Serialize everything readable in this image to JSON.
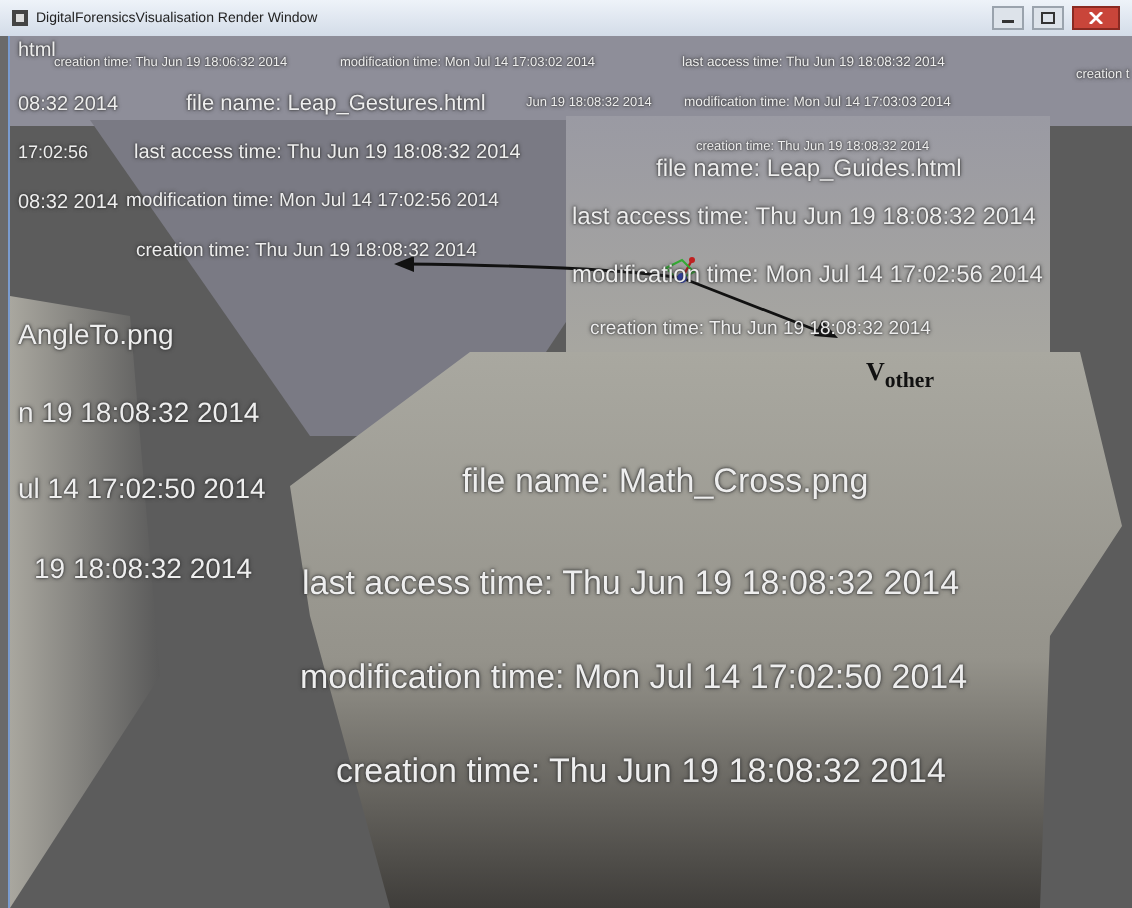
{
  "window": {
    "title": "DigitalForensicsVisualisation Render Window"
  },
  "scene": {
    "labels": [
      "html",
      "creation time: Thu Jun 19 18:06:32 2014",
      "modification time: Mon Jul 14 17:03:02 2014",
      "last access time: Thu Jun 19 18:08:32 2014",
      "creation t",
      "08:32 2014",
      "file name: Leap_Gestures.html",
      "Jun 19 18:08:32 2014",
      "modification time: Mon Jul 14 17:03:03 2014",
      "17:02:56",
      "last access time: Thu Jun 19 18:08:32 2014",
      "creation time: Thu Jun 19 18:08:32 2014",
      "file name: Leap_Guides.html",
      "08:32 2014",
      "modification time: Mon Jul 14 17:02:56 2014",
      "last access time: Thu Jun 19 18:08:32 2014",
      "creation time: Thu Jun 19 18:08:32 2014",
      "modification time: Mon Jul 14 17:02:56 2014",
      "AngleTo.png",
      "creation time: Thu Jun 19 18:08:32 2014",
      "n 19 18:08:32 2014",
      "ul 14 17:02:50 2014",
      "19 18:08:32 2014",
      "file name: Math_Cross.png",
      "last access time: Thu Jun 19 18:08:32 2014",
      "modification time: Mon Jul 14 17:02:50 2014",
      "creation time: Thu Jun 19 18:08:32 2014"
    ],
    "diagram": {
      "vector_label": "V$_{other}$"
    }
  }
}
